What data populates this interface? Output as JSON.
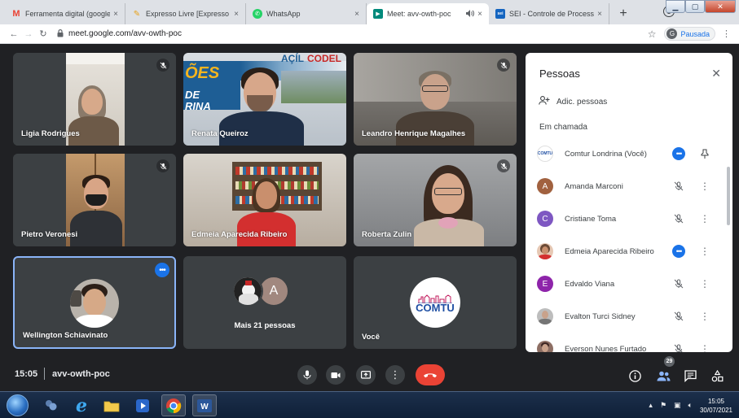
{
  "browser": {
    "tabs": [
      {
        "title": "Ferramenta digital (google",
        "favicon": "M",
        "favicon_color": "#ea4335",
        "active": false
      },
      {
        "title": "Expresso Livre [Expresso M",
        "favicon": "✎",
        "favicon_color": "#e8a21a",
        "active": false
      },
      {
        "title": "WhatsApp",
        "favicon": "✆",
        "favicon_color": "#25d366",
        "active": false
      },
      {
        "title": "Meet: avv-owth-poc",
        "favicon": "▶",
        "favicon_color": "#00897b",
        "active": true
      },
      {
        "title": "SEI - Controle de Processos",
        "favicon": "sei",
        "favicon_color": "#1565c0",
        "active": false
      }
    ],
    "new_tab_label": "+",
    "close_glyph": "×",
    "url": "meet.google.com/avv-owth-poc",
    "profile_initial": "G",
    "profile_status": "Pausada"
  },
  "meet": {
    "tiles": [
      {
        "name": "Ligia Rodrigues",
        "muted": true
      },
      {
        "name": "Renata Queiroz",
        "muted": false
      },
      {
        "name": "Leandro Henrique Magalhes",
        "muted": true
      },
      {
        "name": "Pietro Veronesi",
        "muted": true
      },
      {
        "name": "Edmeia Aparecida Ribeiro",
        "muted": false
      },
      {
        "name": "Roberta Zulin",
        "muted": true
      },
      {
        "name": "Wellington Schiavinato",
        "speaking": true
      },
      {
        "name": "Mais 21 pessoas",
        "avatar_letter": "A"
      },
      {
        "name": "Você",
        "logo_text": "COMTU"
      }
    ],
    "banner_words": [
      "AÇÍL",
      "CODEL",
      "ÕES",
      "DE",
      "RINA"
    ],
    "time": "15:05",
    "code": "avv-owth-poc",
    "people_count": "29",
    "hangup_color": "#ea4335"
  },
  "panel": {
    "title": "Pessoas",
    "add_label": "Adic. pessoas",
    "section_label": "Em chamada",
    "people": [
      {
        "name": "Comtur Londrina (Você)",
        "avatar": "comtu",
        "color": "#ffffff",
        "state": "talking",
        "action": "pin"
      },
      {
        "name": "Amanda Marconi",
        "avatar": "A",
        "color": "#a1613f",
        "state": "muted",
        "action": "more"
      },
      {
        "name": "Cristiane Toma",
        "avatar": "C",
        "color": "#7e57c2",
        "state": "muted",
        "action": "more"
      },
      {
        "name": "Edmeia Aparecida Ribeiro",
        "avatar": "photo",
        "color": "#b07a5a",
        "state": "talking",
        "action": "more"
      },
      {
        "name": "Edvaldo Viana",
        "avatar": "E",
        "color": "#8e24aa",
        "state": "muted",
        "action": "more"
      },
      {
        "name": "Evalton Turci Sidney",
        "avatar": "photo",
        "color": "#9e9e9e",
        "state": "muted",
        "action": "more"
      },
      {
        "name": "Everson Nunes Furtado",
        "avatar": "photo",
        "color": "#6d4c41",
        "state": "muted",
        "action": "more"
      }
    ]
  },
  "taskbar": {
    "time": "15:05",
    "date": "30/07/2021"
  }
}
